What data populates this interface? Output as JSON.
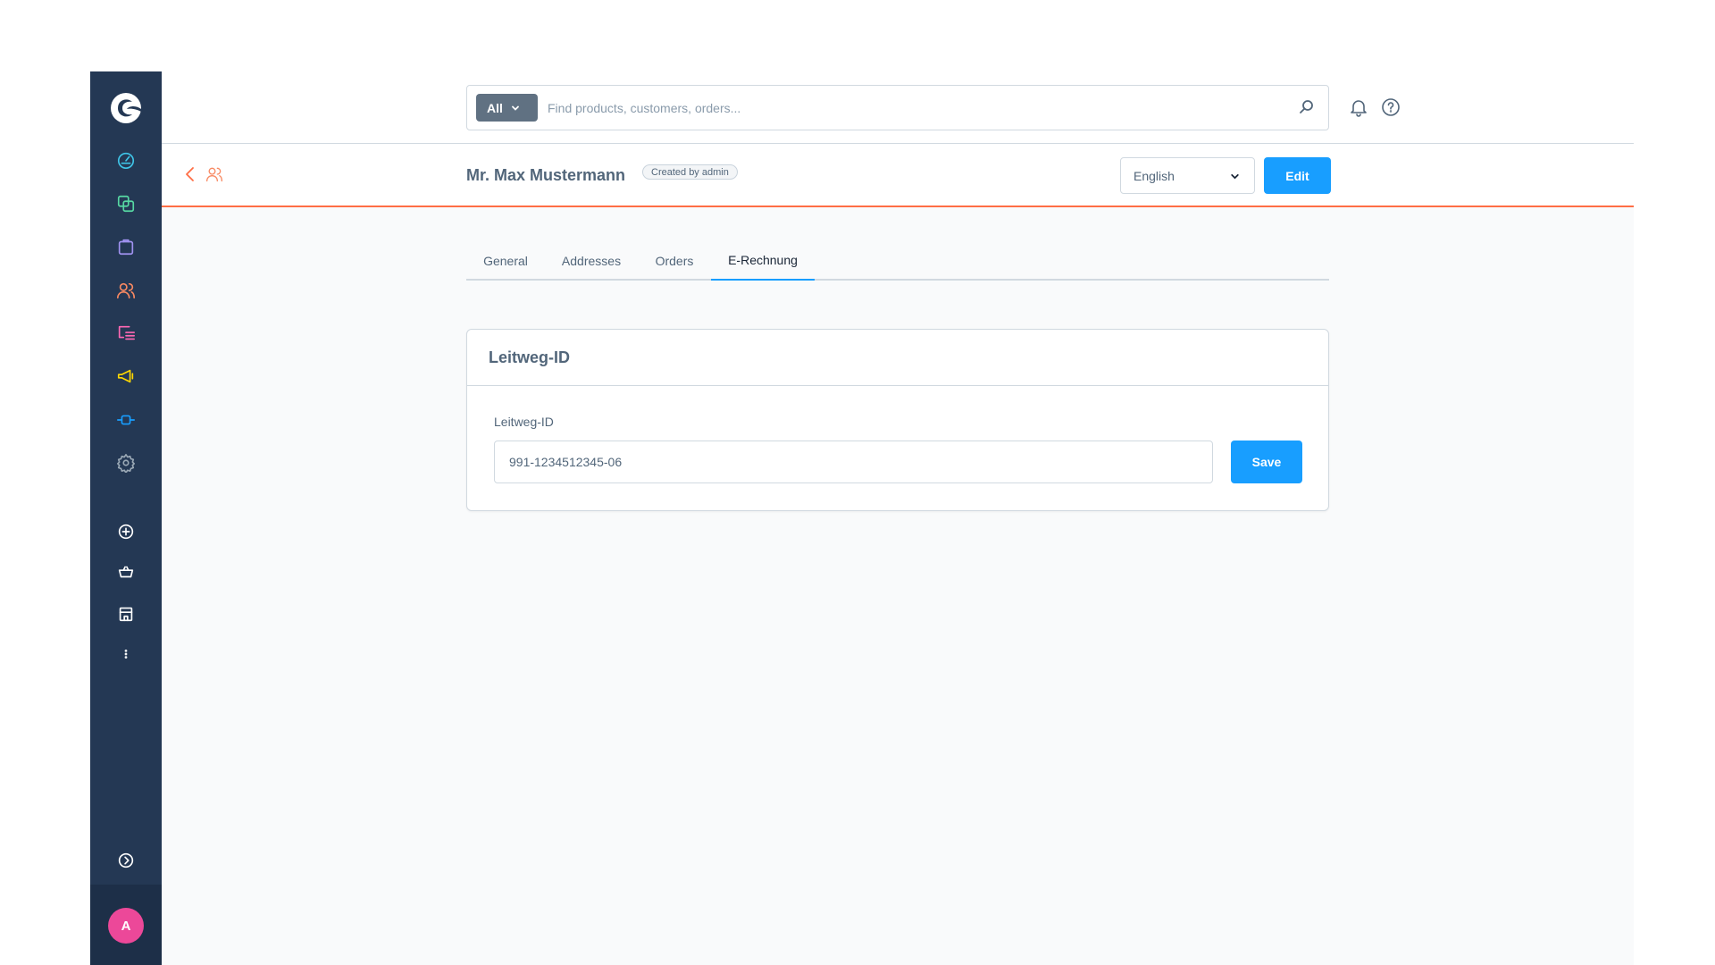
{
  "sidebar": {
    "logo": "shopware-logo",
    "items": [
      {
        "name": "dashboard",
        "icon": "gauge-icon",
        "color": "#3fc5e8"
      },
      {
        "name": "catalogues",
        "icon": "copy-icon",
        "color": "#57d9a3"
      },
      {
        "name": "orders",
        "icon": "shopping-bag-icon",
        "color": "#a092f0"
      },
      {
        "name": "customers",
        "icon": "users-icon",
        "color": "#f88962"
      },
      {
        "name": "content",
        "icon": "content-icon",
        "color": "#ff68b4"
      },
      {
        "name": "marketing",
        "icon": "megaphone-icon",
        "color": "#ffd700"
      },
      {
        "name": "extensions",
        "icon": "plug-icon",
        "color": "#189eff"
      },
      {
        "name": "settings",
        "icon": "gear-icon",
        "color": "#9aa8b5"
      }
    ],
    "secondary": [
      {
        "name": "add-sales-channel",
        "icon": "plus-circle-icon"
      },
      {
        "name": "storefront",
        "icon": "basket-icon"
      },
      {
        "name": "headless",
        "icon": "store-icon"
      },
      {
        "name": "more",
        "icon": "more-vertical-icon"
      }
    ],
    "expand_icon": "chevron-right-circle-icon",
    "avatar_initial": "A",
    "avatar_color": "#ec4899"
  },
  "search": {
    "type_label": "All",
    "placeholder": "Find products, customers, orders..."
  },
  "header": {
    "notification_icon": "bell-icon",
    "help_icon": "help-circle-icon"
  },
  "smartbar": {
    "title": "Mr. Max Mustermann",
    "badge": "Created by admin",
    "language": "English",
    "edit_label": "Edit",
    "accent": "#ff6e45"
  },
  "tabs": [
    {
      "label": "General",
      "active": false
    },
    {
      "label": "Addresses",
      "active": false
    },
    {
      "label": "Orders",
      "active": false
    },
    {
      "label": "E-Rechnung",
      "active": true
    }
  ],
  "card": {
    "title": "Leitweg-ID",
    "field_label": "Leitweg-ID",
    "field_value": "991-1234512345-06",
    "save_label": "Save"
  },
  "colors": {
    "primary": "#189eff",
    "sidebar": "#243854",
    "text": "#52667a"
  }
}
